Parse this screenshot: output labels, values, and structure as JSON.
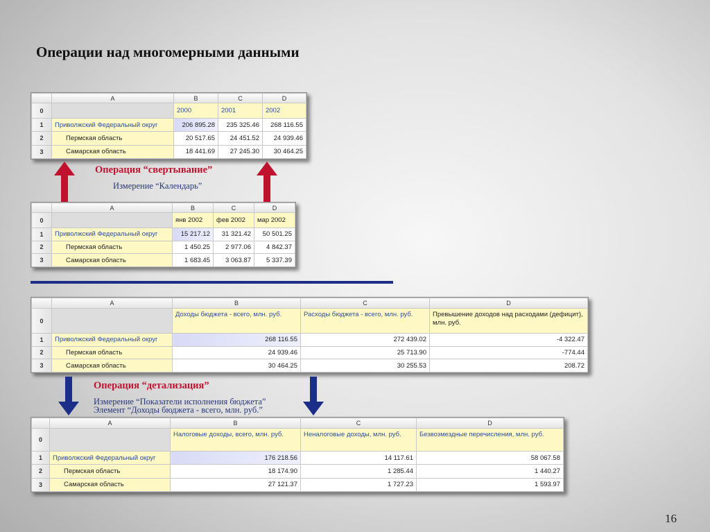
{
  "slide": {
    "title": "Операции над многомерными данными",
    "page_number": "16"
  },
  "colors": {
    "title_red": "#c0122e",
    "navy": "#1b2e88",
    "cell_yellow": "#fdf8c4",
    "header_blue_text": "#2d4fa0"
  },
  "table1": {
    "col_letters": [
      "A",
      "B",
      "C",
      "D"
    ],
    "row_numbers": [
      "0",
      "1",
      "2",
      "3"
    ],
    "headers": [
      "2000",
      "2001",
      "2002"
    ],
    "rows": [
      {
        "label": "Приволжский Федеральный округ",
        "values": [
          "206 895.28",
          "235 325.46",
          "268 116.55"
        ]
      },
      {
        "label": "Пермская область",
        "values": [
          "20 517.65",
          "24 451.52",
          "24 939.46"
        ]
      },
      {
        "label": "Самарская область",
        "values": [
          "18 441.69",
          "27 245.30",
          "30 464.25"
        ]
      }
    ]
  },
  "op1": {
    "title": "Операция “свертывание”",
    "subtitle": "Измерение “Календарь”"
  },
  "table2": {
    "col_letters": [
      "A",
      "B",
      "C",
      "D"
    ],
    "row_numbers": [
      "0",
      "1",
      "2",
      "3"
    ],
    "headers": [
      "янв 2002",
      "фев 2002",
      "мар 2002"
    ],
    "rows": [
      {
        "label": "Приволжский Федеральный округ",
        "values": [
          "15 217.12",
          "31 321.42",
          "50 501.25"
        ]
      },
      {
        "label": "Пермская область",
        "values": [
          "1 450.25",
          "2 977.06",
          "4 842.37"
        ]
      },
      {
        "label": "Самарская область",
        "values": [
          "1 683.45",
          "3 063.87",
          "5 337.39"
        ]
      }
    ]
  },
  "table3": {
    "col_letters": [
      "A",
      "B",
      "C",
      "D"
    ],
    "row_numbers": [
      "0",
      "1",
      "2",
      "3"
    ],
    "headers": [
      "Доходы бюджета - всего, млн. руб.",
      "Расходы бюджета - всего, млн. руб.",
      "Превышение доходов над расходами (дефицит),  млн. руб."
    ],
    "rows": [
      {
        "label": "Приволжский Федеральный округ",
        "values": [
          "268 116.55",
          "272 439.02",
          "-4 322.47"
        ]
      },
      {
        "label": "Пермская область",
        "values": [
          "24 939.46",
          "25 713.90",
          "-774.44"
        ]
      },
      {
        "label": "Самарская область",
        "values": [
          "30 464.25",
          "30 255.53",
          "208.72"
        ]
      }
    ]
  },
  "op2": {
    "title": "Операция “детализация”",
    "subtitle_line1": "Измерение “Показатели исполнения бюджета”",
    "subtitle_line2": "Элемент “Доходы бюджета - всего, млн. руб.”"
  },
  "table4": {
    "col_letters": [
      "A",
      "B",
      "C",
      "D"
    ],
    "row_numbers": [
      "0",
      "1",
      "2",
      "3"
    ],
    "headers": [
      "Налоговые доходы, всего, млн. руб.",
      "Неналоговые доходы, млн. руб.",
      "Безвозмездные перечисления, млн. руб."
    ],
    "rows": [
      {
        "label": "Приволжский Федеральный округ",
        "values": [
          "176 218.56",
          "14 117.61",
          "58 067.58"
        ]
      },
      {
        "label": "Пермская область",
        "values": [
          "18 174.90",
          "1 285.44",
          "1 440.27"
        ]
      },
      {
        "label": "Самарская область",
        "values": [
          "27 121.37",
          "1 727.23",
          "1 593.97"
        ]
      }
    ]
  }
}
